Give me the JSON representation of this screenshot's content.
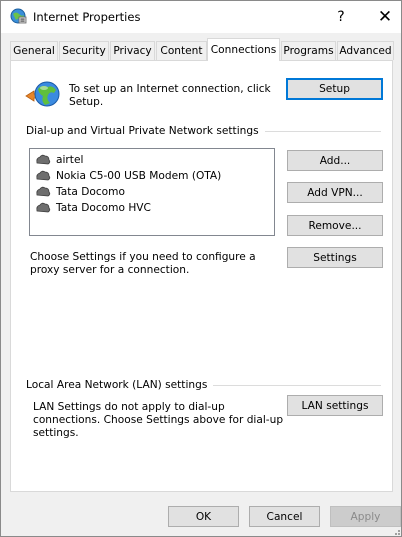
{
  "window": {
    "title": "Internet Properties",
    "help_glyph": "?",
    "close_glyph": "✕"
  },
  "tabs": [
    {
      "label": "General"
    },
    {
      "label": "Security"
    },
    {
      "label": "Privacy"
    },
    {
      "label": "Content"
    },
    {
      "label": "Connections",
      "active": true
    },
    {
      "label": "Programs"
    },
    {
      "label": "Advanced"
    }
  ],
  "setup": {
    "text": "To set up an Internet connection, click Setup.",
    "button": "Setup"
  },
  "dialup": {
    "group_label": "Dial-up and Virtual Private Network settings",
    "connections": [
      {
        "name": "airtel"
      },
      {
        "name": "Nokia C5-00 USB Modem (OTA)"
      },
      {
        "name": "Tata Docomo"
      },
      {
        "name": "Tata Docomo HVC"
      }
    ],
    "add_button": "Add...",
    "add_vpn_button": "Add VPN...",
    "remove_button": "Remove...",
    "proxy_text": "Choose Settings if you need to configure a proxy server for a connection.",
    "settings_button": "Settings"
  },
  "lan": {
    "group_label": "Local Area Network (LAN) settings",
    "text": "LAN Settings do not apply to dial-up connections. Choose Settings above for dial-up settings.",
    "button": "LAN settings"
  },
  "footer": {
    "ok": "OK",
    "cancel": "Cancel",
    "apply": "Apply"
  },
  "icons": {
    "title": "internet-options-icon",
    "setup": "globe-connection-icon",
    "connection": "dialup-connection-icon"
  },
  "colors": {
    "accent_border": "#0078d7",
    "button_face": "#e1e1e1",
    "window_bg": "#f0f0f0"
  }
}
